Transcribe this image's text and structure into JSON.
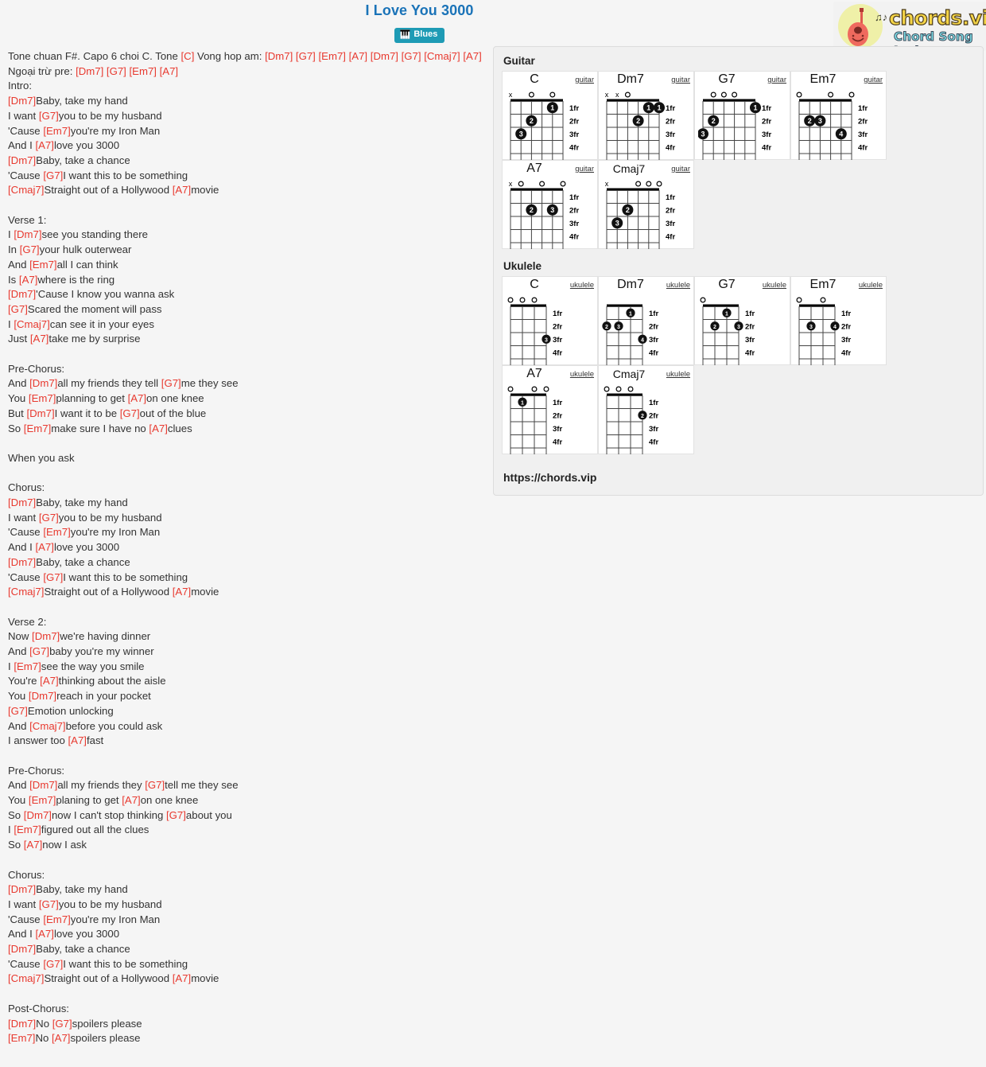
{
  "header": {
    "title": "I Love You 3000",
    "genre_badge": "Blues",
    "genre_icon": "blues-tag-icon"
  },
  "logo": {
    "brand": "chords.vip",
    "tagline": "Chord Song Lyric",
    "icon": "guitar-icon"
  },
  "footer": {
    "url": "https://chords.vip"
  },
  "panels": {
    "guitar_heading": "Guitar",
    "ukulele_heading": "Ukulele",
    "fret_labels": [
      "1fr",
      "2fr",
      "3fr",
      "4fr"
    ],
    "guitar_instrument_label": "guitar",
    "ukulele_instrument_label": "ukulele"
  },
  "lyrics": [
    {
      "type": "line",
      "parts": [
        {
          "t": "Tone chuan F#. Capo 6 choi C. Tone "
        },
        {
          "c": "[C]"
        },
        {
          "t": " Vong hop am: "
        },
        {
          "c": "[Dm7]"
        },
        {
          "t": " "
        },
        {
          "c": "[G7]"
        },
        {
          "t": " "
        },
        {
          "c": "[Em7]"
        },
        {
          "t": " "
        },
        {
          "c": "[A7]"
        },
        {
          "t": " "
        },
        {
          "c": "[Dm7]"
        },
        {
          "t": " "
        },
        {
          "c": "[G7]"
        },
        {
          "t": " "
        },
        {
          "c": "[Cmaj7]"
        },
        {
          "t": " "
        },
        {
          "c": "[A7]"
        },
        {
          "t": " Ngoại trừ pre: "
        },
        {
          "c": "[Dm7]"
        },
        {
          "t": " "
        },
        {
          "c": "[G7]"
        },
        {
          "t": " "
        },
        {
          "c": "[Em7]"
        },
        {
          "t": " "
        },
        {
          "c": "[A7]"
        }
      ]
    },
    {
      "type": "line",
      "parts": [
        {
          "t": "Intro:"
        }
      ]
    },
    {
      "type": "line",
      "parts": [
        {
          "c": "[Dm7]"
        },
        {
          "t": "Baby, take my hand"
        }
      ]
    },
    {
      "type": "line",
      "parts": [
        {
          "t": "I want "
        },
        {
          "c": "[G7]"
        },
        {
          "t": "you to be my husband"
        }
      ]
    },
    {
      "type": "line",
      "parts": [
        {
          "t": "'Cause "
        },
        {
          "c": "[Em7]"
        },
        {
          "t": "you're my Iron Man"
        }
      ]
    },
    {
      "type": "line",
      "parts": [
        {
          "t": "And I "
        },
        {
          "c": "[A7]"
        },
        {
          "t": "love you 3000"
        }
      ]
    },
    {
      "type": "line",
      "parts": [
        {
          "c": "[Dm7]"
        },
        {
          "t": "Baby, take a chance"
        }
      ]
    },
    {
      "type": "line",
      "parts": [
        {
          "t": "'Cause "
        },
        {
          "c": "[G7]"
        },
        {
          "t": "I want this to be something"
        }
      ]
    },
    {
      "type": "line",
      "parts": [
        {
          "c": "[Cmaj7]"
        },
        {
          "t": "Straight out of a Hollywood "
        },
        {
          "c": "[A7]"
        },
        {
          "t": "movie"
        }
      ]
    },
    {
      "type": "blank"
    },
    {
      "type": "line",
      "parts": [
        {
          "t": "Verse 1:"
        }
      ]
    },
    {
      "type": "line",
      "parts": [
        {
          "t": "I "
        },
        {
          "c": "[Dm7]"
        },
        {
          "t": "see you standing there"
        }
      ]
    },
    {
      "type": "line",
      "parts": [
        {
          "t": "In "
        },
        {
          "c": "[G7]"
        },
        {
          "t": "your hulk outerwear"
        }
      ]
    },
    {
      "type": "line",
      "parts": [
        {
          "t": "And "
        },
        {
          "c": "[Em7]"
        },
        {
          "t": "all I can think"
        }
      ]
    },
    {
      "type": "line",
      "parts": [
        {
          "t": "Is "
        },
        {
          "c": "[A7]"
        },
        {
          "t": "where is the ring"
        }
      ]
    },
    {
      "type": "line",
      "parts": [
        {
          "c": "[Dm7]"
        },
        {
          "t": "'Cause I know you wanna ask"
        }
      ]
    },
    {
      "type": "line",
      "parts": [
        {
          "c": "[G7]"
        },
        {
          "t": "Scared the moment will pass"
        }
      ]
    },
    {
      "type": "line",
      "parts": [
        {
          "t": "I "
        },
        {
          "c": "[Cmaj7]"
        },
        {
          "t": "can see it in your eyes"
        }
      ]
    },
    {
      "type": "line",
      "parts": [
        {
          "t": "Just "
        },
        {
          "c": "[A7]"
        },
        {
          "t": "take me by surprise"
        }
      ]
    },
    {
      "type": "blank"
    },
    {
      "type": "line",
      "parts": [
        {
          "t": "Pre-Chorus:"
        }
      ]
    },
    {
      "type": "line",
      "parts": [
        {
          "t": "And "
        },
        {
          "c": "[Dm7]"
        },
        {
          "t": "all my friends they tell "
        },
        {
          "c": "[G7]"
        },
        {
          "t": "me they see"
        }
      ]
    },
    {
      "type": "line",
      "parts": [
        {
          "t": "You "
        },
        {
          "c": "[Em7]"
        },
        {
          "t": "planning to get "
        },
        {
          "c": "[A7]"
        },
        {
          "t": "on one knee"
        }
      ]
    },
    {
      "type": "line",
      "parts": [
        {
          "t": "But "
        },
        {
          "c": "[Dm7]"
        },
        {
          "t": "I want it to be "
        },
        {
          "c": "[G7]"
        },
        {
          "t": "out of the blue"
        }
      ]
    },
    {
      "type": "line",
      "parts": [
        {
          "t": "So "
        },
        {
          "c": "[Em7]"
        },
        {
          "t": "make sure I have no "
        },
        {
          "c": "[A7]"
        },
        {
          "t": "clues"
        }
      ]
    },
    {
      "type": "blank"
    },
    {
      "type": "line",
      "parts": [
        {
          "t": "When you ask"
        }
      ]
    },
    {
      "type": "blank"
    },
    {
      "type": "line",
      "parts": [
        {
          "t": "Chorus:"
        }
      ]
    },
    {
      "type": "line",
      "parts": [
        {
          "c": "[Dm7]"
        },
        {
          "t": "Baby, take my hand"
        }
      ]
    },
    {
      "type": "line",
      "parts": [
        {
          "t": "I want "
        },
        {
          "c": "[G7]"
        },
        {
          "t": "you to be my husband"
        }
      ]
    },
    {
      "type": "line",
      "parts": [
        {
          "t": "'Cause "
        },
        {
          "c": "[Em7]"
        },
        {
          "t": "you're my Iron Man"
        }
      ]
    },
    {
      "type": "line",
      "parts": [
        {
          "t": "And I "
        },
        {
          "c": "[A7]"
        },
        {
          "t": "love you 3000"
        }
      ]
    },
    {
      "type": "line",
      "parts": [
        {
          "c": "[Dm7]"
        },
        {
          "t": "Baby, take a chance"
        }
      ]
    },
    {
      "type": "line",
      "parts": [
        {
          "t": "'Cause "
        },
        {
          "c": "[G7]"
        },
        {
          "t": "I want this to be something"
        }
      ]
    },
    {
      "type": "line",
      "parts": [
        {
          "c": "[Cmaj7]"
        },
        {
          "t": "Straight out of a Hollywood "
        },
        {
          "c": "[A7]"
        },
        {
          "t": "movie"
        }
      ]
    },
    {
      "type": "blank"
    },
    {
      "type": "line",
      "parts": [
        {
          "t": "Verse 2:"
        }
      ]
    },
    {
      "type": "line",
      "parts": [
        {
          "t": "Now "
        },
        {
          "c": "[Dm7]"
        },
        {
          "t": "we're having dinner"
        }
      ]
    },
    {
      "type": "line",
      "parts": [
        {
          "t": "And "
        },
        {
          "c": "[G7]"
        },
        {
          "t": "baby you're my winner"
        }
      ]
    },
    {
      "type": "line",
      "parts": [
        {
          "t": "I "
        },
        {
          "c": "[Em7]"
        },
        {
          "t": "see the way you smile"
        }
      ]
    },
    {
      "type": "line",
      "parts": [
        {
          "t": "You're "
        },
        {
          "c": "[A7]"
        },
        {
          "t": "thinking about the aisle"
        }
      ]
    },
    {
      "type": "line",
      "parts": [
        {
          "t": "You "
        },
        {
          "c": "[Dm7]"
        },
        {
          "t": "reach in your pocket"
        }
      ]
    },
    {
      "type": "line",
      "parts": [
        {
          "c": "[G7]"
        },
        {
          "t": "Emotion unlocking"
        }
      ]
    },
    {
      "type": "line",
      "parts": [
        {
          "t": "And "
        },
        {
          "c": "[Cmaj7]"
        },
        {
          "t": "before you could ask"
        }
      ]
    },
    {
      "type": "line",
      "parts": [
        {
          "t": "I answer too "
        },
        {
          "c": "[A7]"
        },
        {
          "t": "fast"
        }
      ]
    },
    {
      "type": "blank"
    },
    {
      "type": "line",
      "parts": [
        {
          "t": "Pre-Chorus:"
        }
      ]
    },
    {
      "type": "line",
      "parts": [
        {
          "t": "And "
        },
        {
          "c": "[Dm7]"
        },
        {
          "t": "all my friends they "
        },
        {
          "c": "[G7]"
        },
        {
          "t": "tell me they see"
        }
      ]
    },
    {
      "type": "line",
      "parts": [
        {
          "t": "You "
        },
        {
          "c": "[Em7]"
        },
        {
          "t": "planing to get "
        },
        {
          "c": "[A7]"
        },
        {
          "t": "on one knee"
        }
      ]
    },
    {
      "type": "line",
      "parts": [
        {
          "t": "So "
        },
        {
          "c": "[Dm7]"
        },
        {
          "t": "now I can't stop thinking "
        },
        {
          "c": "[G7]"
        },
        {
          "t": "about you"
        }
      ]
    },
    {
      "type": "line",
      "parts": [
        {
          "t": "I "
        },
        {
          "c": "[Em7]"
        },
        {
          "t": "figured out all the clues"
        }
      ]
    },
    {
      "type": "line",
      "parts": [
        {
          "t": "So "
        },
        {
          "c": "[A7]"
        },
        {
          "t": "now I ask"
        }
      ]
    },
    {
      "type": "blank"
    },
    {
      "type": "line",
      "parts": [
        {
          "t": "Chorus:"
        }
      ]
    },
    {
      "type": "line",
      "parts": [
        {
          "c": "[Dm7]"
        },
        {
          "t": "Baby, take my hand"
        }
      ]
    },
    {
      "type": "line",
      "parts": [
        {
          "t": "I want "
        },
        {
          "c": "[G7]"
        },
        {
          "t": "you to be my husband"
        }
      ]
    },
    {
      "type": "line",
      "parts": [
        {
          "t": "'Cause "
        },
        {
          "c": "[Em7]"
        },
        {
          "t": "you're my Iron Man"
        }
      ]
    },
    {
      "type": "line",
      "parts": [
        {
          "t": "And I "
        },
        {
          "c": "[A7]"
        },
        {
          "t": "love you 3000"
        }
      ]
    },
    {
      "type": "line",
      "parts": [
        {
          "c": "[Dm7]"
        },
        {
          "t": "Baby, take a chance"
        }
      ]
    },
    {
      "type": "line",
      "parts": [
        {
          "t": "'Cause "
        },
        {
          "c": "[G7]"
        },
        {
          "t": "I want this to be something"
        }
      ]
    },
    {
      "type": "line",
      "parts": [
        {
          "c": "[Cmaj7]"
        },
        {
          "t": "Straight out of a Hollywood "
        },
        {
          "c": "[A7]"
        },
        {
          "t": "movie"
        }
      ]
    },
    {
      "type": "blank"
    },
    {
      "type": "line",
      "parts": [
        {
          "t": "Post-Chorus:"
        }
      ]
    },
    {
      "type": "line",
      "parts": [
        {
          "c": "[Dm7]"
        },
        {
          "t": "No "
        },
        {
          "c": "[G7]"
        },
        {
          "t": "spoilers please"
        }
      ]
    },
    {
      "type": "line",
      "parts": [
        {
          "c": "[Em7]"
        },
        {
          "t": "No "
        },
        {
          "c": "[A7]"
        },
        {
          "t": "spoilers please"
        }
      ]
    }
  ],
  "guitar_chords": [
    {
      "name": "C",
      "instrument": "guitar",
      "strings": 6,
      "open": [
        "x",
        "",
        "o",
        "",
        "o",
        ""
      ],
      "dots": [
        {
          "string": 5,
          "fret": 1,
          "finger": "1"
        },
        {
          "string": 3,
          "fret": 2,
          "finger": "2"
        },
        {
          "string": 2,
          "fret": 3,
          "finger": "3"
        }
      ]
    },
    {
      "name": "Dm7",
      "instrument": "guitar",
      "strings": 6,
      "open": [
        "x",
        "x",
        "o",
        "",
        "",
        ""
      ],
      "dots": [
        {
          "string": 5,
          "fret": 1,
          "finger": "1"
        },
        {
          "string": 6,
          "fret": 1,
          "finger": "1"
        },
        {
          "string": 4,
          "fret": 2,
          "finger": "2"
        }
      ]
    },
    {
      "name": "G7",
      "instrument": "guitar",
      "strings": 6,
      "open": [
        "",
        "o",
        "o",
        "o",
        "",
        " "
      ],
      "dots": [
        {
          "string": 6,
          "fret": 1,
          "finger": "1"
        },
        {
          "string": 2,
          "fret": 2,
          "finger": "2"
        },
        {
          "string": 1,
          "fret": 3,
          "finger": "3"
        }
      ]
    },
    {
      "name": "Em7",
      "instrument": "guitar",
      "strings": 6,
      "open": [
        "o",
        "",
        "",
        "o",
        "",
        "o"
      ],
      "dots": [
        {
          "string": 2,
          "fret": 2,
          "finger": "2"
        },
        {
          "string": 3,
          "fret": 2,
          "finger": "3"
        },
        {
          "string": 5,
          "fret": 3,
          "finger": "4"
        }
      ]
    },
    {
      "name": "A7",
      "instrument": "guitar",
      "strings": 6,
      "open": [
        "x",
        "o",
        "",
        "o",
        "",
        "o"
      ],
      "dots": [
        {
          "string": 3,
          "fret": 2,
          "finger": "2"
        },
        {
          "string": 5,
          "fret": 2,
          "finger": "3"
        }
      ]
    },
    {
      "name": "Cmaj7",
      "instrument": "guitar",
      "strings": 6,
      "open": [
        "x",
        "",
        "",
        "o",
        "o",
        "o"
      ],
      "dots": [
        {
          "string": 3,
          "fret": 2,
          "finger": "2"
        },
        {
          "string": 2,
          "fret": 3,
          "finger": "3"
        }
      ]
    }
  ],
  "ukulele_chords": [
    {
      "name": "C",
      "instrument": "ukulele",
      "strings": 4,
      "open": [
        "o",
        "o",
        "o",
        ""
      ],
      "dots": [
        {
          "string": 4,
          "fret": 3,
          "finger": "3"
        }
      ]
    },
    {
      "name": "Dm7",
      "instrument": "ukulele",
      "strings": 4,
      "open": [
        "",
        "",
        "",
        ""
      ],
      "dots": [
        {
          "string": 3,
          "fret": 1,
          "finger": "1"
        },
        {
          "string": 1,
          "fret": 2,
          "finger": "2"
        },
        {
          "string": 2,
          "fret": 2,
          "finger": "3"
        },
        {
          "string": 4,
          "fret": 3,
          "finger": "4"
        }
      ]
    },
    {
      "name": "G7",
      "instrument": "ukulele",
      "strings": 4,
      "open": [
        "o",
        "",
        "",
        ""
      ],
      "dots": [
        {
          "string": 3,
          "fret": 1,
          "finger": "1"
        },
        {
          "string": 2,
          "fret": 2,
          "finger": "2"
        },
        {
          "string": 4,
          "fret": 2,
          "finger": "3"
        }
      ]
    },
    {
      "name": "Em7",
      "instrument": "ukulele",
      "strings": 4,
      "open": [
        "o",
        "",
        "o",
        ""
      ],
      "dots": [
        {
          "string": 2,
          "fret": 2,
          "finger": "3"
        },
        {
          "string": 4,
          "fret": 2,
          "finger": "4"
        }
      ]
    },
    {
      "name": "A7",
      "instrument": "ukulele",
      "strings": 4,
      "open": [
        "o",
        "",
        "o",
        "o"
      ],
      "dots": [
        {
          "string": 2,
          "fret": 1,
          "finger": "1"
        }
      ]
    },
    {
      "name": "Cmaj7",
      "instrument": "ukulele",
      "strings": 4,
      "open": [
        "o",
        "o",
        "o",
        ""
      ],
      "dots": [
        {
          "string": 4,
          "fret": 2,
          "finger": "2"
        }
      ]
    }
  ],
  "colors": {
    "title": "#1a73b8",
    "chord": "#e8392f",
    "badge": "#1e9bb5",
    "panel_bg": "#f0f0f0"
  }
}
